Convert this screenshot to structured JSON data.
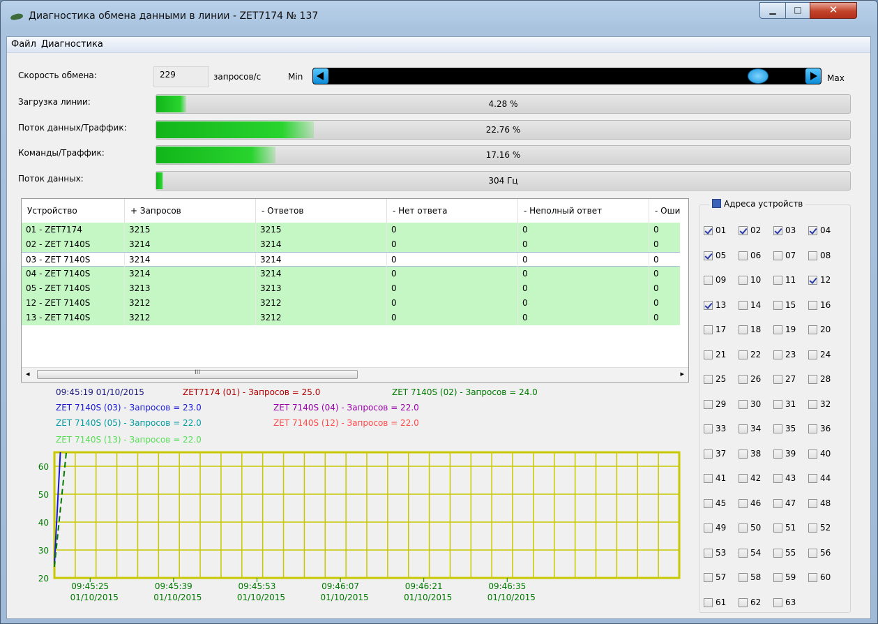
{
  "window": {
    "title": "Диагностика обмена данными в линии - ZET7174 № 137",
    "minimize_glyph": "▁",
    "maximize_glyph": "□",
    "close_glyph": "✕"
  },
  "menu": [
    "Файл",
    "Диагностика"
  ],
  "speed": {
    "label": "Скорость обмена:",
    "value": "229",
    "unit": "запросов/с",
    "min_label": "Min",
    "max_label": "Max",
    "level": 0.92
  },
  "bars": [
    {
      "label": "Загрузка линии:",
      "text": "4.28 %",
      "fraction": 0.0428
    },
    {
      "label": "Поток данных/Траффик:",
      "text": "22.76 %",
      "fraction": 0.2276
    },
    {
      "label": "Команды/Траффик:",
      "text": "17.16 %",
      "fraction": 0.1716
    },
    {
      "label": "Поток данных:",
      "text": "304 Гц",
      "fraction": 0.01
    }
  ],
  "table": {
    "headers": [
      "Устройство",
      "+ Запросов",
      "- Ответов",
      "- Нет ответа",
      "- Неполный ответ",
      "- Оши"
    ],
    "rows": [
      [
        "01 - ZET7174",
        "3215",
        "3215",
        "0",
        "0",
        "0"
      ],
      [
        "02 - ZET 7140S",
        "3214",
        "3214",
        "0",
        "0",
        "0"
      ],
      [
        "03 - ZET 7140S",
        "3214",
        "3214",
        "0",
        "0",
        "0"
      ],
      [
        "04 - ZET 7140S",
        "3214",
        "3214",
        "0",
        "0",
        "0"
      ],
      [
        "05 - ZET 7140S",
        "3213",
        "3213",
        "0",
        "0",
        "0"
      ],
      [
        "12 - ZET 7140S",
        "3212",
        "3212",
        "0",
        "0",
        "0"
      ],
      [
        "13 - ZET 7140S",
        "3212",
        "3212",
        "0",
        "0",
        "0"
      ]
    ],
    "selected_row": 2,
    "scroll_grip": "III",
    "scroll_left": "◂",
    "scroll_right": "▸"
  },
  "addresses": {
    "title": "Адреса устройств",
    "items": [
      "01",
      "02",
      "03",
      "04",
      "05",
      "06",
      "07",
      "08",
      "09",
      "10",
      "11",
      "12",
      "13",
      "14",
      "15",
      "16",
      "17",
      "18",
      "19",
      "20",
      "21",
      "22",
      "23",
      "24",
      "25",
      "26",
      "27",
      "28",
      "29",
      "30",
      "31",
      "32",
      "33",
      "34",
      "35",
      "36",
      "37",
      "38",
      "39",
      "40",
      "41",
      "42",
      "43",
      "44",
      "45",
      "46",
      "47",
      "48",
      "49",
      "50",
      "51",
      "52",
      "53",
      "54",
      "55",
      "56",
      "57",
      "58",
      "59",
      "60",
      "61",
      "62",
      "63"
    ],
    "checked": [
      "01",
      "02",
      "03",
      "04",
      "05",
      "12",
      "13"
    ]
  },
  "chart_data": {
    "type": "line",
    "timestamp_label": "09:45:19 01/10/2015",
    "legend": [
      {
        "text": "ZET7174 (01) - Запросов = 25.0",
        "color": "#b00000"
      },
      {
        "text": "ZET 7140S (02) - Запросов = 24.0",
        "color": "#007a00"
      },
      {
        "text": "ZET 7140S (03) - Запросов = 23.0",
        "color": "#1a1ad6"
      },
      {
        "text": "ZET 7140S (04) - Запросов = 22.0",
        "color": "#9900aa"
      },
      {
        "text": "ZET 7140S (05) - Запросов = 22.0",
        "color": "#009aa0"
      },
      {
        "text": "ZET 7140S (12) - Запросов = 22.0",
        "color": "#ff4a4a"
      },
      {
        "text": "ZET 7140S (13) - Запросов = 22.0",
        "color": "#55dd55"
      }
    ],
    "y_ticks": [
      20,
      30,
      40,
      50,
      60
    ],
    "ylim": [
      20,
      65
    ],
    "x_ticks": [
      {
        "time": "09:45:25",
        "date": "01/10/2015"
      },
      {
        "time": "09:45:39",
        "date": "01/10/2015"
      },
      {
        "time": "09:45:53",
        "date": "01/10/2015"
      },
      {
        "time": "09:46:07",
        "date": "01/10/2015"
      },
      {
        "time": "09:46:21",
        "date": "01/10/2015"
      },
      {
        "time": "09:46:35",
        "date": "01/10/2015"
      }
    ],
    "series": [
      {
        "name": "ZET7174 (01)",
        "color": "#1a1ad6",
        "x": [
          "09:45:19",
          "09:45:20"
        ],
        "y": [
          25,
          65
        ]
      },
      {
        "name": "ZET 7140S (02)",
        "color": "#007a00",
        "x": [
          "09:45:19",
          "09:45:21"
        ],
        "y": [
          24,
          65
        ]
      }
    ],
    "grid": true,
    "grid_color": "#c8c800",
    "text_color": "#007a00"
  }
}
